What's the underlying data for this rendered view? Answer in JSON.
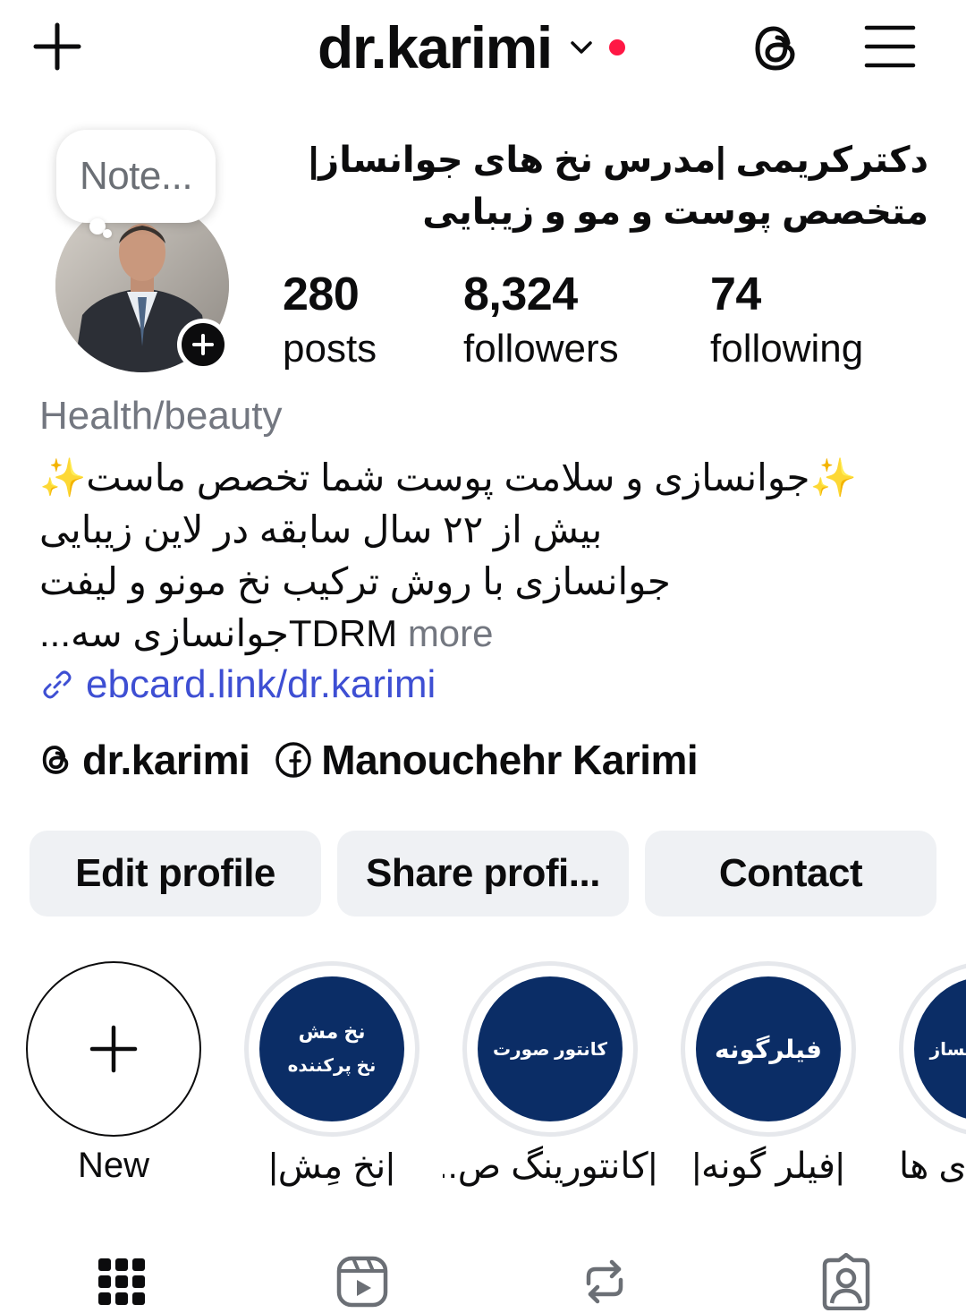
{
  "header": {
    "username": "dr.karimi",
    "has_notification_dot": true,
    "icons": [
      "plus-icon",
      "chevron-down-icon",
      "threads-icon",
      "menu-icon"
    ]
  },
  "note": {
    "placeholder": "Note..."
  },
  "profile": {
    "name_line1": "دکترکریمی |مدرس نخ های جوانساز|",
    "name_line2": "متخصص پوست و مو و زیبایی",
    "stats": [
      {
        "value": "280",
        "label": "posts"
      },
      {
        "value": "8,324",
        "label": "followers"
      },
      {
        "value": "74",
        "label": "following"
      }
    ],
    "category": "Health/beauty",
    "bio": [
      "✨جوانسازی و سلامت پوست شما تخصص ماست✨",
      "بیش از ۲۲ سال سابقه در لاین زیبایی",
      "جوانسازی با روش ترکیب نخ مونو و لیفت",
      "TDRMجوانسازی سه..."
    ],
    "more_label": "more",
    "link": "ebcard.link/dr.karimi",
    "threads_handle": "dr.karimi",
    "facebook_name": "Manouchehr Karimi"
  },
  "actions": {
    "edit": "Edit profile",
    "share": "Share profi...",
    "contact": "Contact"
  },
  "highlights": [
    {
      "label": "New",
      "cover_lines": []
    },
    {
      "label": "|نخ مِش|",
      "cover_lines": [
        "نخ مش",
        "نخ پرکننده"
      ]
    },
    {
      "label": "|کانتورینگ ص...",
      "cover_lines": [
        "کانتور صورت"
      ]
    },
    {
      "label": "|فیلر گونه|",
      "cover_lines": [
        "فیلرگونه"
      ]
    },
    {
      "label": "|ی ها",
      "cover_lines": [
        "نساز"
      ]
    }
  ],
  "tabs": [
    "grid-icon",
    "reels-icon",
    "reposts-icon",
    "tagged-icon"
  ],
  "colors": {
    "highlight_bg": "#0b2d66",
    "link": "#3e4fd3",
    "button_bg": "#eff1f4",
    "notification_dot": "#ff1744"
  }
}
